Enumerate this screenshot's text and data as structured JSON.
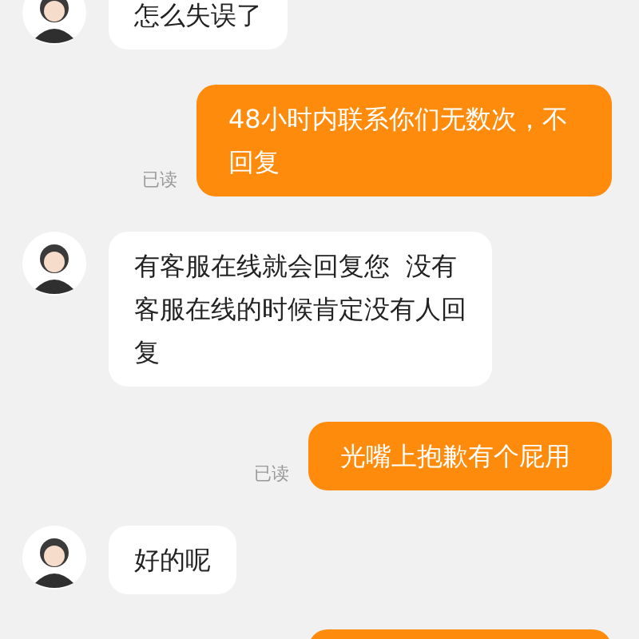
{
  "messages": [
    {
      "kind": "received",
      "text": "怎么失误了"
    },
    {
      "kind": "sent",
      "text": "48小时内联系你们无数次，不回复",
      "read_label": "已读"
    },
    {
      "kind": "received",
      "text": "有客服在线就会回复您  没有客服在线的时候肯定没有人回复"
    },
    {
      "kind": "sent",
      "text": "光嘴上抱歉有个屁用",
      "read_label": "已读"
    },
    {
      "kind": "received",
      "text": "好的呢"
    },
    {
      "kind": "sent"
    }
  ]
}
